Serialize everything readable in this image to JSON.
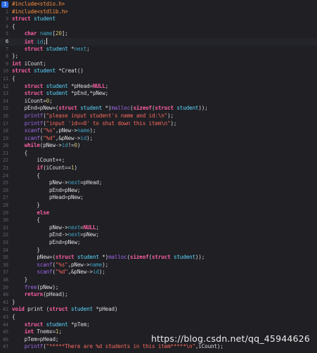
{
  "editor": {
    "current_line": 6,
    "lines": [
      {
        "n": "1",
        "c": "#include<stdio.h>"
      },
      {
        "n": "2",
        "c": "#include<stdlib.h>"
      },
      {
        "n": "3",
        "c": "struct student"
      },
      {
        "n": "4",
        "c": "{"
      },
      {
        "n": "5",
        "c": "    char name[20];"
      },
      {
        "n": "6",
        "c": "    int id;"
      },
      {
        "n": "7",
        "c": "    struct student *next;"
      },
      {
        "n": "8",
        "c": "};"
      },
      {
        "n": "9",
        "c": "int iCount;"
      },
      {
        "n": "10",
        "c": "struct student *Creat()"
      },
      {
        "n": "11",
        "c": "{"
      },
      {
        "n": "12",
        "c": "    struct student *pHead=NULL;"
      },
      {
        "n": "13",
        "c": "    struct student *pEnd,*pNew;"
      },
      {
        "n": "14",
        "c": "    iCount=0;"
      },
      {
        "n": "15",
        "c": "    pEnd=pNew=(struct student *)malloc(sizeof(struct student));"
      },
      {
        "n": "16",
        "c": "    printf(\"please input student's name and id:\\n\");"
      },
      {
        "n": "17",
        "c": "    printf(\"input 'id==0' to shut down this item\\n\");"
      },
      {
        "n": "18",
        "c": "    scanf(\"%s\",pNew->name);"
      },
      {
        "n": "19",
        "c": "    scanf(\"%d\",&pNew->id);"
      },
      {
        "n": "20",
        "c": "    while(pNew->id!=0)"
      },
      {
        "n": "21",
        "c": "    {"
      },
      {
        "n": "22",
        "c": "        iCount++;"
      },
      {
        "n": "23",
        "c": "        if(iCount==1)"
      },
      {
        "n": "24",
        "c": "        {"
      },
      {
        "n": "25",
        "c": "            pNew->next=pHead;"
      },
      {
        "n": "26",
        "c": "            pEnd=pNew;"
      },
      {
        "n": "27",
        "c": "            pHead=pNew;"
      },
      {
        "n": "28",
        "c": "        }"
      },
      {
        "n": "29",
        "c": "        else"
      },
      {
        "n": "30",
        "c": "        {"
      },
      {
        "n": "31",
        "c": "            pNew->next=NULL;"
      },
      {
        "n": "32",
        "c": "            pEnd->next=pNew;"
      },
      {
        "n": "33",
        "c": "            pEnd=pNew;"
      },
      {
        "n": "34",
        "c": "        }"
      },
      {
        "n": "35",
        "c": "        pNew=(struct student *)malloc(sizeof(struct student));"
      },
      {
        "n": "36",
        "c": "        scanf(\"%s\",pNew->name);"
      },
      {
        "n": "37",
        "c": "        scanf(\"%d\",&pNew->id);"
      },
      {
        "n": "38",
        "c": "    }"
      },
      {
        "n": "39",
        "c": "    free(pNew);"
      },
      {
        "n": "40",
        "c": "    return(pHead);"
      },
      {
        "n": "41",
        "c": "}"
      },
      {
        "n": "42",
        "c": "void print (struct student *pHead)"
      },
      {
        "n": "43",
        "c": "{"
      },
      {
        "n": "44",
        "c": "    struct student *pTem;"
      },
      {
        "n": "45",
        "c": "    int Tnemx=1;"
      },
      {
        "n": "46",
        "c": "    pTem=pHead;"
      },
      {
        "n": "47",
        "c": "    printf(\"*****There are %d students in this item*****\\n\",iCount);"
      }
    ]
  },
  "watermark": "https://blog.csdn.net/qq_45944626",
  "colors": {
    "background": "#1f1f24",
    "keyword": "#fc5fa3",
    "preprocessor": "#fd8f3f",
    "string": "#fc6a5d",
    "number": "#d0bf69",
    "function": "#a167e6",
    "line_badge": "#2f6feb"
  }
}
